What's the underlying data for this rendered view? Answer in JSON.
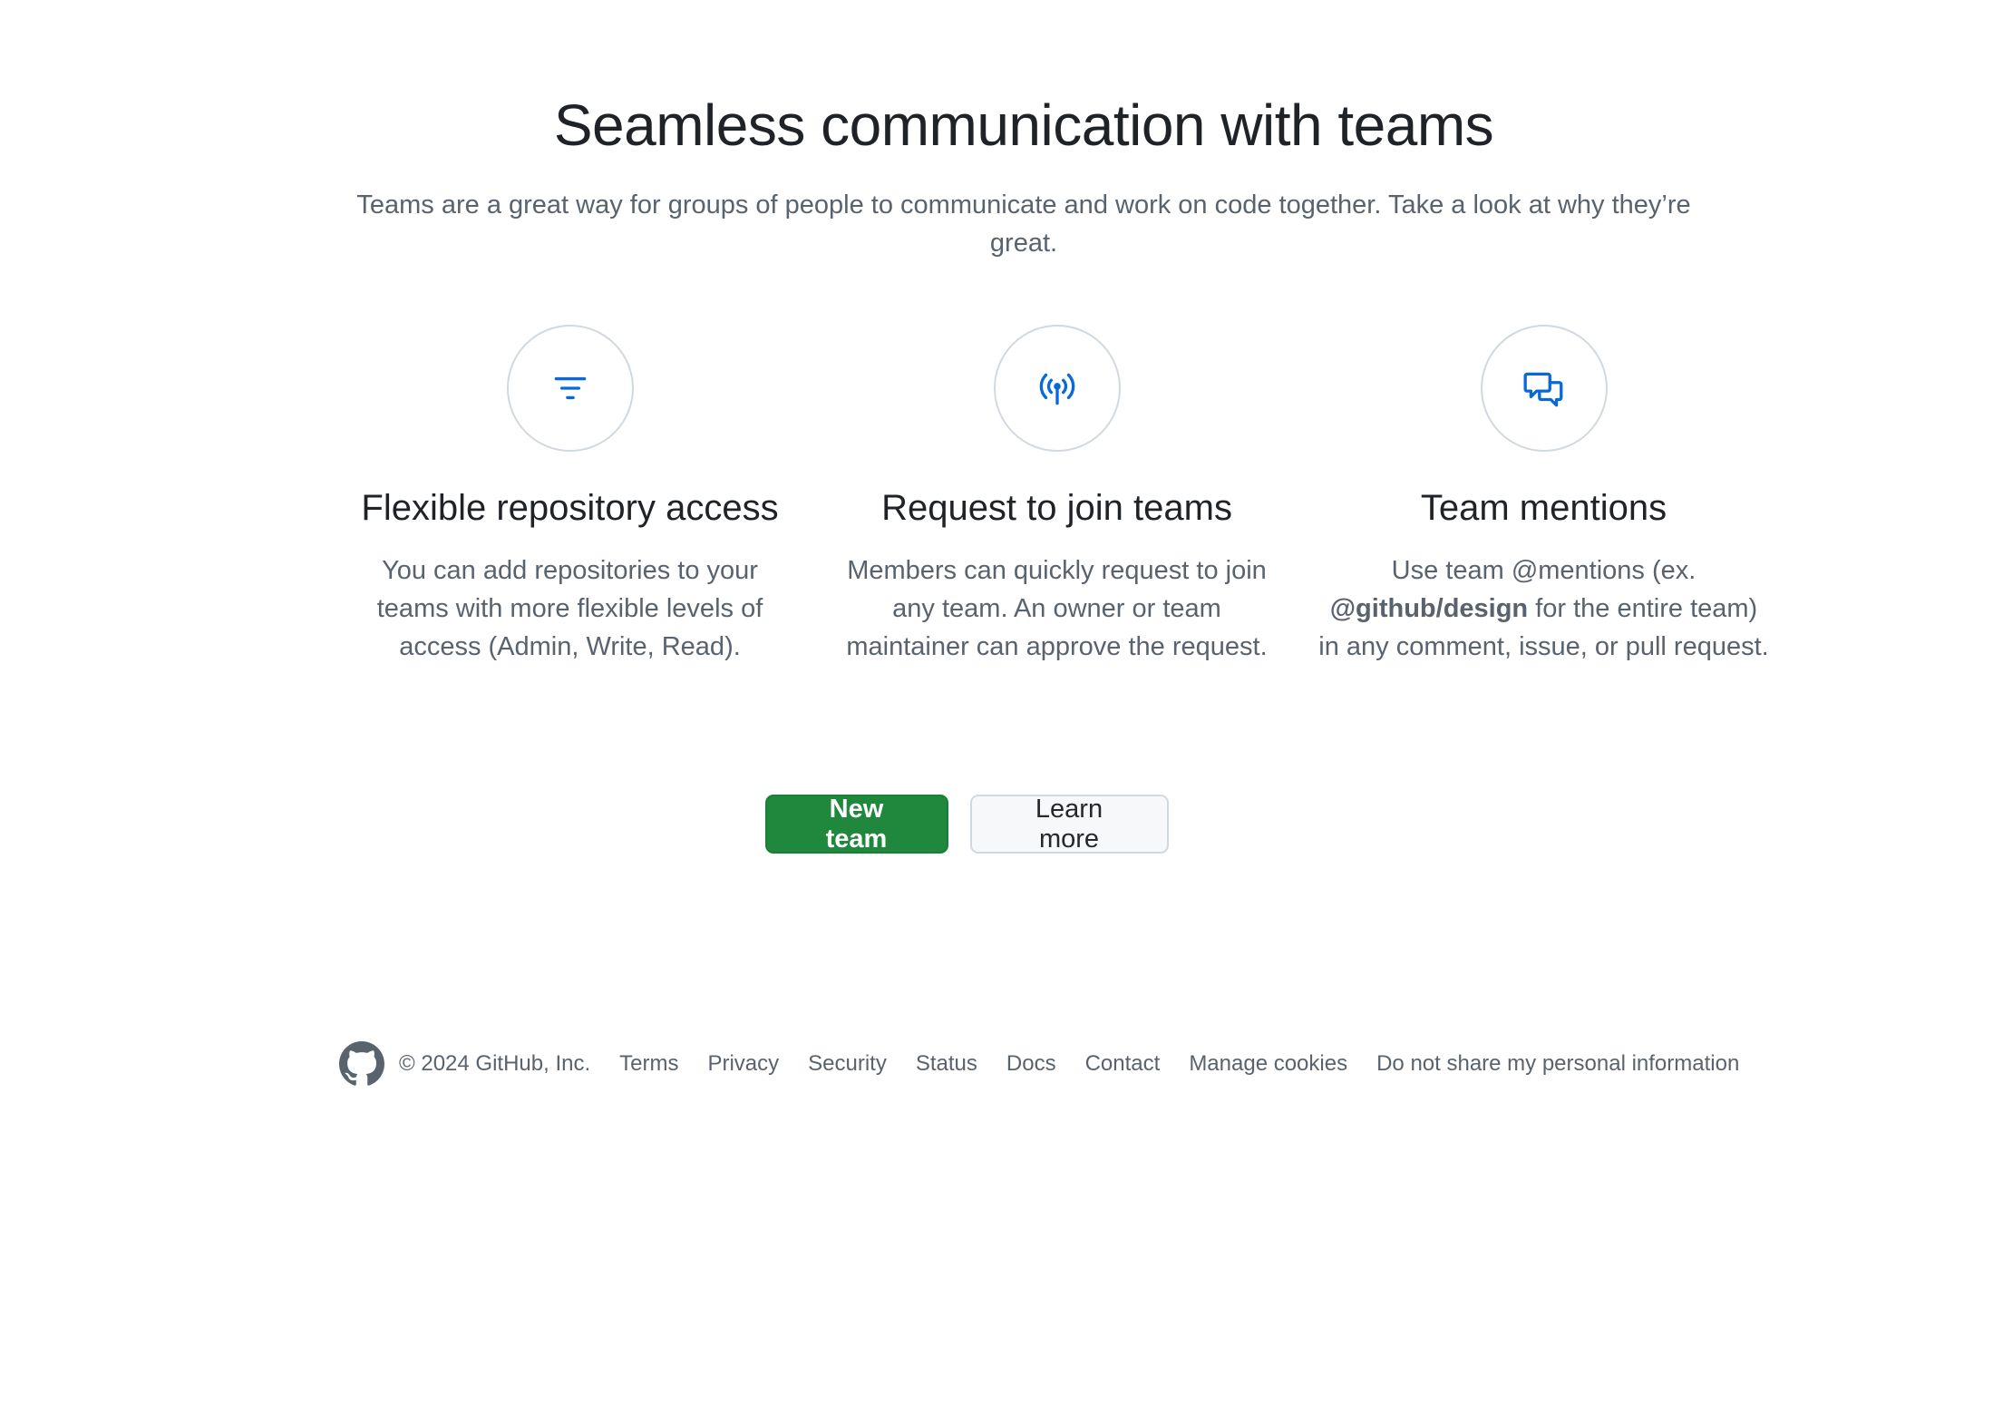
{
  "hero": {
    "title": "Seamless communication with teams",
    "intro": "Teams are a great way for groups of people to communicate and work on code together. Take a look at why they’re great."
  },
  "features": [
    {
      "icon": "filter-icon",
      "title": "Flexible repository access",
      "description": "You can add repositories to your teams with more flexible levels of access (Admin, Write, Read)."
    },
    {
      "icon": "broadcast-icon",
      "title": "Request to join teams",
      "description": "Members can quickly request to join any team. An owner or team maintainer can approve the request."
    },
    {
      "icon": "comment-discussion-icon",
      "title": "Team mentions",
      "description_prefix": "Use team @mentions (ex. ",
      "description_bold": "@github/design",
      "description_suffix": " for the entire team) in any comment, issue, or pull request."
    }
  ],
  "actions": {
    "new_team": "New team",
    "learn_more": "Learn more"
  },
  "footer": {
    "copyright": "© 2024 GitHub, Inc.",
    "links": [
      "Terms",
      "Privacy",
      "Security",
      "Status",
      "Docs",
      "Contact",
      "Manage cookies",
      "Do not share my personal information"
    ]
  },
  "colors": {
    "accent_icon": "#0969da",
    "primary_button": "#1f883d",
    "muted_text": "#59636e"
  }
}
